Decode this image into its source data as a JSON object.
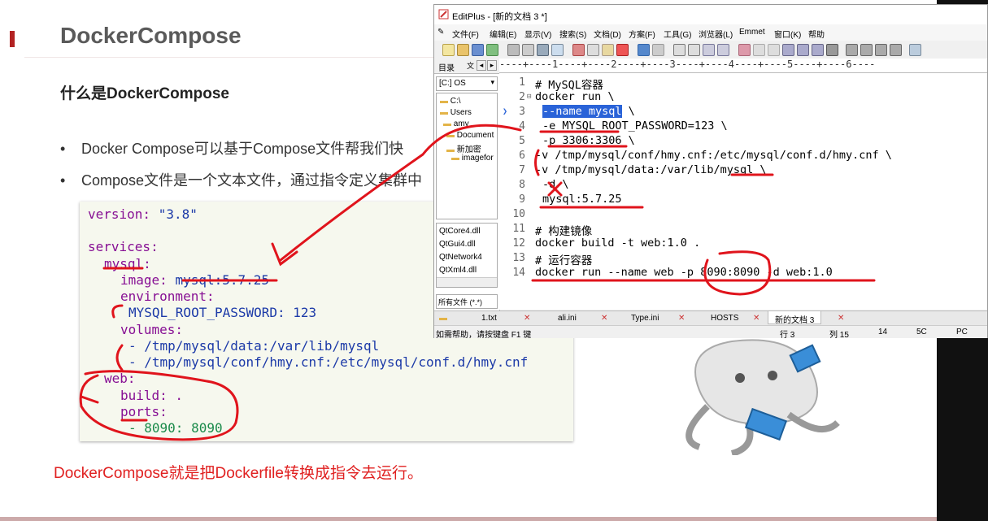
{
  "slide": {
    "title": "DockerCompose",
    "subtitle": "什么是DockerCompose",
    "bullets": [
      "Docker Compose可以基于Compose文件帮我们快",
      "Compose文件是一个文本文件，通过指令定义集群中"
    ],
    "bullet_symbol": "•",
    "code": {
      "l1": "version: \"3.8\"",
      "l2": "services:",
      "l3": "mysql:",
      "l4k": "image: ",
      "l4v": "mysql:5.7.25",
      "l5": "environment:",
      "l6": "MYSQL_ROOT_PASSWORD: 123",
      "l7": "volumes:",
      "l8": "- /tmp/mysql/data:/var/lib/mysql",
      "l9": "- /tmp/mysql/conf/hmy.cnf:/etc/mysql/conf.d/hmy.cnf",
      "l10": "web:",
      "l11": "build: .",
      "l12": "ports:",
      "l13": "- 8090: 8090"
    },
    "note": "DockerCompose就是把Dockerfile转换成指令去运行。"
  },
  "editor": {
    "title": "EditPlus - [新的文档 3 *]",
    "menu": [
      "文件(F)",
      "编辑(E)",
      "显示(V)",
      "搜索(S)",
      "文档(D)",
      "方案(F)",
      "工具(G)",
      "浏览器(L)",
      "Emmet",
      "窗口(K)",
      "帮助"
    ],
    "sidebar": {
      "tab_label": "目录",
      "drive": "[C:] OS",
      "folders": [
        "C:\\",
        "Users",
        "amy",
        "Document",
        "新加密",
        "imagefor"
      ],
      "files": [
        "QtCore4.dll",
        "QtGui4.dll",
        "QtNetwork4",
        "QtXml4.dll"
      ],
      "filter": "所有文件 (*.*)"
    },
    "ruler": "----+----1----+----2----+----3----+----4----+----5----+----6----",
    "lines": [
      "# MySQL容器",
      "docker run \\",
      "--name mysql",
      "-e MYSQL_ROOT_PASSWORD=123 \\",
      "-p 3306:3306 \\",
      "-v /tmp/mysql/conf/hmy.cnf:/etc/mysql/conf.d/hmy.cnf \\",
      "-v /tmp/mysql/data:/var/lib/mysql \\",
      "-d \\",
      "mysql:5.7.25",
      "",
      "# 构建镜像",
      "docker build -t web:1.0 .",
      "# 运行容器",
      "docker run --name web -p 8090:8090 -d web:1.0"
    ],
    "line_numbers": [
      "1",
      "2",
      "3",
      "4",
      "5",
      "6",
      "7",
      "8",
      "9",
      "10",
      "11",
      "12",
      "13",
      "14"
    ],
    "line3_tail": " \\",
    "tabs": [
      "1.txt",
      "ali.ini",
      "Type.ini",
      "HOSTS",
      "新的文档 3"
    ],
    "status": {
      "help": "如需帮助，请按键盘 F1 键",
      "row": "行 3",
      "col": "列 15",
      "n1": "14",
      "n2": "5C",
      "mode": "PC"
    }
  }
}
